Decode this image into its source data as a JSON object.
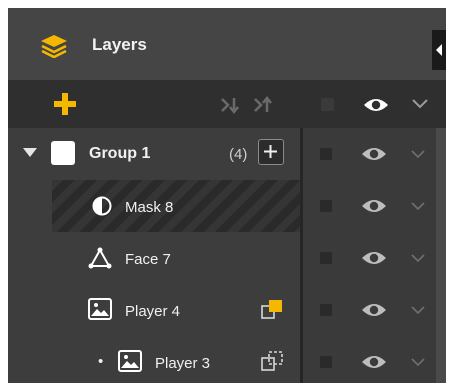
{
  "panel": {
    "title": "Layers",
    "icons": {
      "header": "layers-icon",
      "add": "plus-icon",
      "sort_down": "move-down-icon",
      "sort_up": "move-up-icon",
      "visibility": "eye-icon",
      "expand": "chevron-down-icon"
    },
    "accent_color": "#f5b800"
  },
  "layers": [
    {
      "name": "Group 1",
      "count": "(4)",
      "type": "group",
      "expanded": true
    },
    {
      "name": "Mask 8",
      "type": "mask"
    },
    {
      "name": "Face 7",
      "type": "face"
    },
    {
      "name": "Player 4",
      "type": "image"
    },
    {
      "name": "Player 3",
      "type": "image",
      "bullet": "•"
    }
  ]
}
